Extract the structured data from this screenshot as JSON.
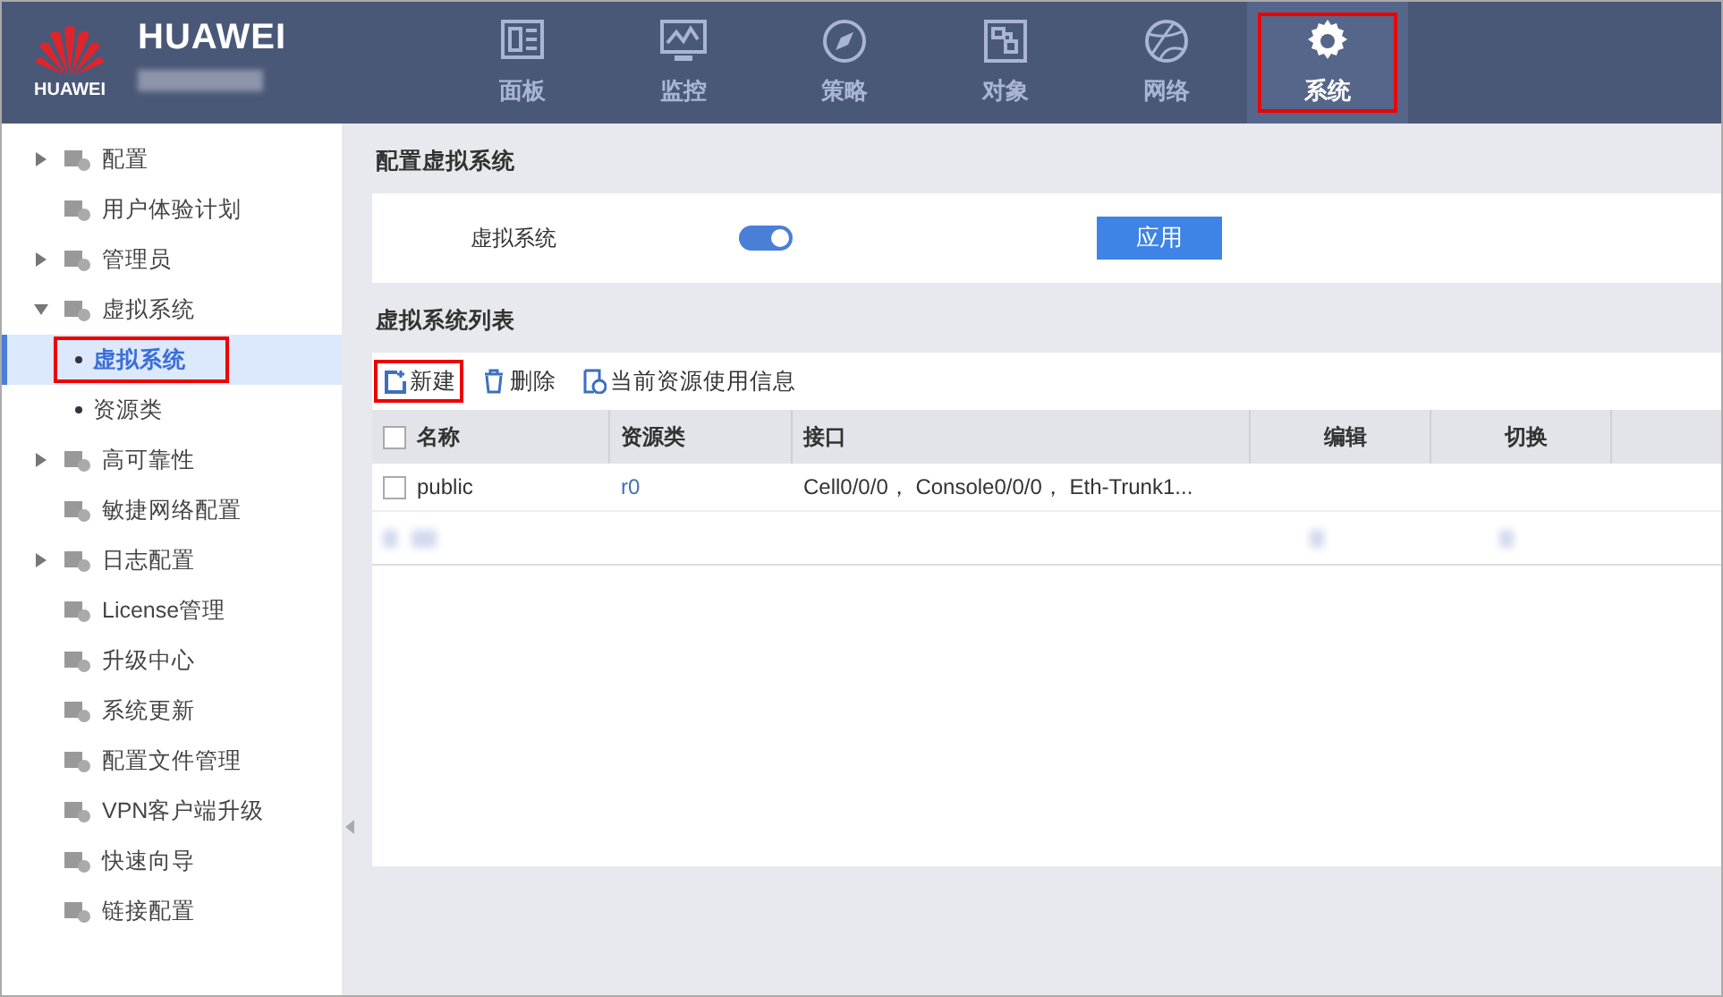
{
  "header": {
    "brand": "HUAWEI",
    "logo_text": "HUAWEI"
  },
  "tabs": [
    {
      "label": "面板",
      "selected": false,
      "annotated": false
    },
    {
      "label": "监控",
      "selected": false,
      "annotated": false
    },
    {
      "label": "策略",
      "selected": false,
      "annotated": false
    },
    {
      "label": "对象",
      "selected": false,
      "annotated": false
    },
    {
      "label": "网络",
      "selected": false,
      "annotated": false
    },
    {
      "label": "系统",
      "selected": true,
      "annotated": true
    }
  ],
  "sidebar": {
    "items": [
      {
        "label": "配置",
        "expanded": false
      },
      {
        "label": "用户体验计划"
      },
      {
        "label": "管理员",
        "expanded": false
      },
      {
        "label": "虚拟系统",
        "expanded": true,
        "children": [
          {
            "label": "虚拟系统",
            "selected": true,
            "annotated": true
          },
          {
            "label": "资源类",
            "selected": false,
            "annotated": false
          }
        ]
      },
      {
        "label": "高可靠性",
        "expanded": false
      },
      {
        "label": "敏捷网络配置"
      },
      {
        "label": "日志配置",
        "expanded": false
      },
      {
        "label": "License管理"
      },
      {
        "label": "升级中心"
      },
      {
        "label": "系统更新"
      },
      {
        "label": "配置文件管理"
      },
      {
        "label": "VPN客户端升级"
      },
      {
        "label": "快速向导"
      },
      {
        "label": "链接配置"
      }
    ]
  },
  "config_section": {
    "title": "配置虚拟系统",
    "field_label": "虚拟系统",
    "switch_on": true,
    "apply_button": "应用"
  },
  "list_section": {
    "title": "虚拟系统列表",
    "toolbar": [
      {
        "label": "新建",
        "annotated": true
      },
      {
        "label": "删除",
        "annotated": false
      },
      {
        "label": "当前资源使用信息",
        "annotated": false
      }
    ],
    "table": {
      "select_all_checked": false,
      "columns": [
        "名称",
        "资源类",
        "接口",
        "编辑",
        "切换"
      ],
      "rows": [
        {
          "checked": false,
          "name": "public",
          "resource_class": "r0",
          "interfaces": "Cell0/0/0， Console0/0/0， Eth-Trunk1..."
        }
      ]
    }
  }
}
